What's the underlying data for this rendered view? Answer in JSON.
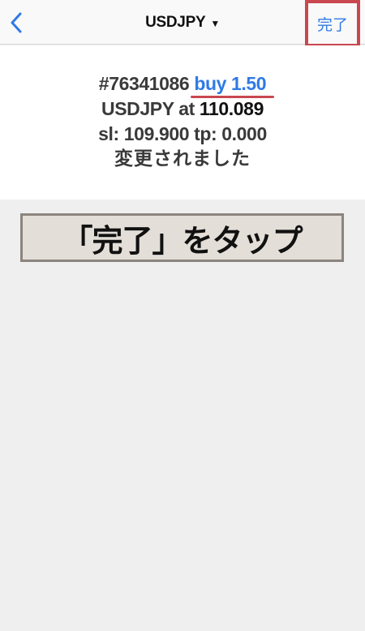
{
  "navbar": {
    "back_icon": "chevron-left-icon",
    "title": "USDJPY",
    "title_caret": "▼",
    "done_label": "完了"
  },
  "message": {
    "ticket": "#76341086",
    "order": "buy 1.50",
    "symbol_at": "USDJPY at",
    "price": "110.089",
    "sl_tp": "sl: 109.900 tp: 0.000",
    "status": "変更されました"
  },
  "instruction": {
    "text": "「完了」をタップ"
  },
  "colors": {
    "accent_blue": "#2f7ae5",
    "highlight_red": "#c9474e",
    "background": "#efefef",
    "instruction_bg": "#e3ded8"
  }
}
